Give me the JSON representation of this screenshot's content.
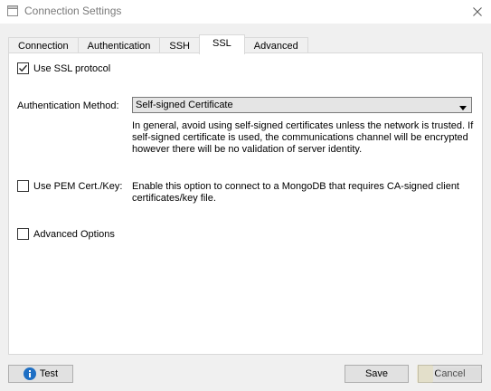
{
  "window": {
    "title": "Connection Settings"
  },
  "tabs": [
    {
      "label": "Connection"
    },
    {
      "label": "Authentication"
    },
    {
      "label": "SSH"
    },
    {
      "label": "SSL"
    },
    {
      "label": "Advanced"
    }
  ],
  "active_tab": "SSL",
  "ssl": {
    "use_ssl": {
      "label": "Use SSL protocol",
      "checked": true
    },
    "auth_method": {
      "label": "Authentication Method:",
      "value": "Self-signed Certificate",
      "help": "In general, avoid using self-signed certificates unless the network is trusted. If self-signed certificate is used, the communications channel will be encrypted however there will be no validation of server identity."
    },
    "use_pem": {
      "label": "Use PEM Cert./Key:",
      "checked": false,
      "help": "Enable this option to connect to a MongoDB that requires CA-signed client certificates/key file."
    },
    "advanced_options": {
      "label": "Advanced Options",
      "checked": false
    }
  },
  "buttons": {
    "test": "Test",
    "save": "Save",
    "cancel": "Cancel"
  },
  "colors": {
    "info_blue": "#1e6fc4",
    "panel_bg": "#ffffff",
    "window_bg": "#f0f0f0"
  }
}
